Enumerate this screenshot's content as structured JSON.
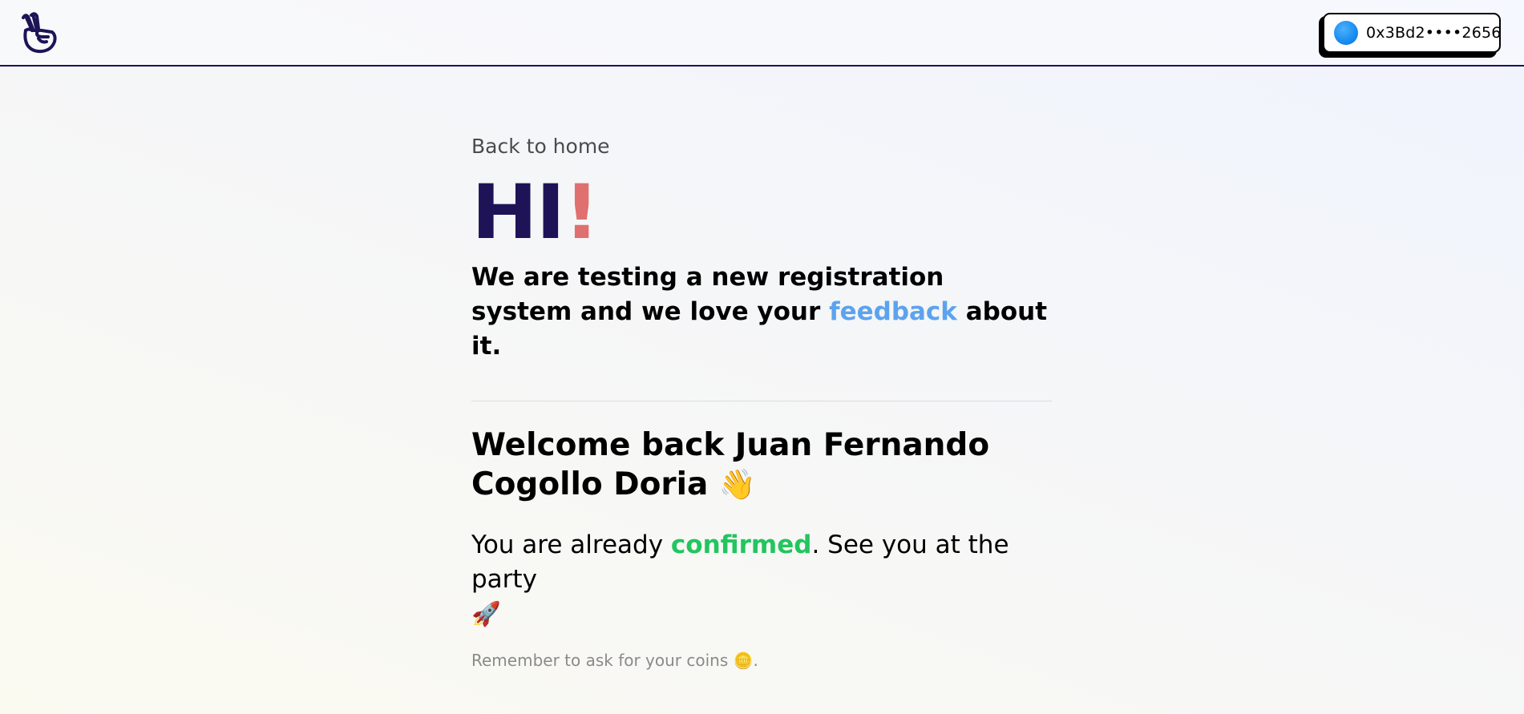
{
  "header": {
    "logo_icon": "peace-hand-icon",
    "wallet": {
      "avatar_color": "#1a8ff2",
      "address": "0x3Bd2••••2656"
    }
  },
  "main": {
    "back_link": "Back to home",
    "hi": {
      "text": "HI",
      "bang": "!",
      "text_color": "#1e1357",
      "bang_color": "#e06f70"
    },
    "intro": {
      "before": "We are testing a new registration system and we love your ",
      "link": "feedback",
      "after": " about it."
    },
    "welcome": {
      "text": "Welcome back Juan Fernando Cogollo Doria",
      "emoji": "👋"
    },
    "status": {
      "before": "You are already ",
      "highlight": "confirmed",
      "after": ". See you at the party",
      "emoji": "🚀",
      "highlight_color": "#22c55e"
    },
    "reminder": {
      "text": "Remember to ask for your coins",
      "emoji": "🪙",
      "end": "."
    }
  }
}
